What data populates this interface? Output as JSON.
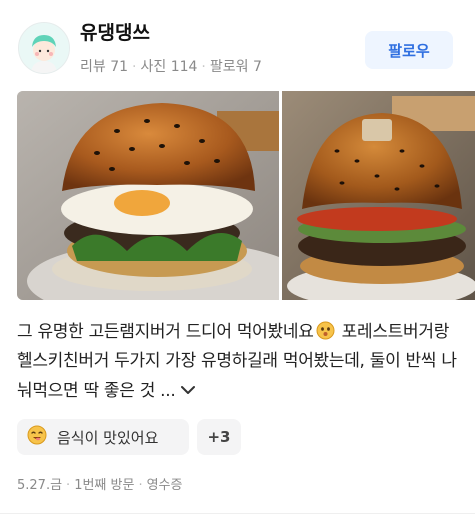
{
  "user": {
    "nickname": "유댕댕쓰",
    "reviews_label": "리뷰 71",
    "photos_label": "사진 114",
    "followers_label": "팔로워 7",
    "follow_button": "팔로우"
  },
  "photos": [
    {
      "name": "burger-photo-1"
    },
    {
      "name": "burger-photo-2"
    }
  ],
  "review": {
    "text_part1": "그 유명한 고든램지버거 드디어 먹어봤네요",
    "text_part2": " 포레스트버거랑 헬스키친버거 두가지 가장 유명하길래 먹어봤는데, 둘이 반씩 나눠먹으면 딱 좋은 것 ..."
  },
  "chips": {
    "taste_label": "음식이 맛있어요",
    "more_label": "+3"
  },
  "meta": {
    "date": "5.27.금",
    "visit": "1번째 방문",
    "receipt": "영수증"
  }
}
